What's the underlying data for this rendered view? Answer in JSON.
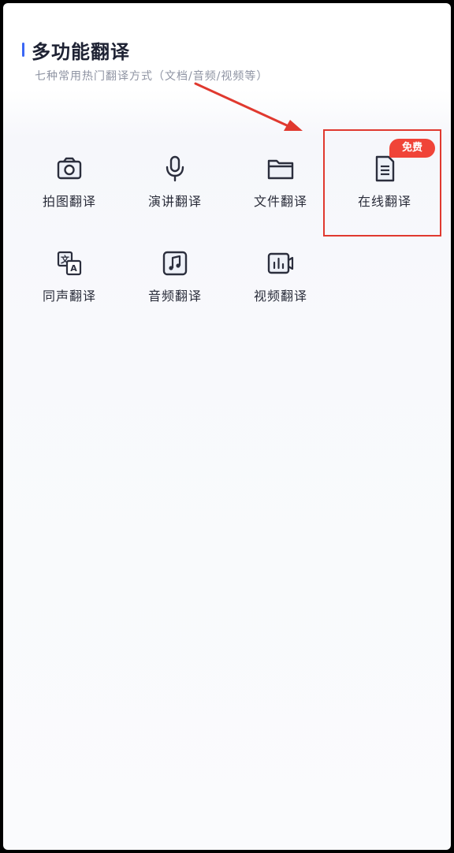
{
  "header": {
    "title": "多功能翻译",
    "subtitle": "七种常用热门翻译方式（文档/音频/视频等）"
  },
  "tools": [
    {
      "label": "拍图翻译",
      "icon": "camera-icon"
    },
    {
      "label": "演讲翻译",
      "icon": "microphone-icon"
    },
    {
      "label": "文件翻译",
      "icon": "folder-icon"
    },
    {
      "label": "在线翻译",
      "icon": "document-icon",
      "badge": "免费"
    },
    {
      "label": "同声翻译",
      "icon": "bilingual-translate-icon"
    },
    {
      "label": "音频翻译",
      "icon": "music-note-icon"
    },
    {
      "label": "视频翻译",
      "icon": "video-chart-icon"
    }
  ],
  "colors": {
    "accent": "#3b67f5",
    "icon_stroke": "#2b2e3d",
    "annotation_red": "#e0392f",
    "badge_red": "#f04438"
  }
}
